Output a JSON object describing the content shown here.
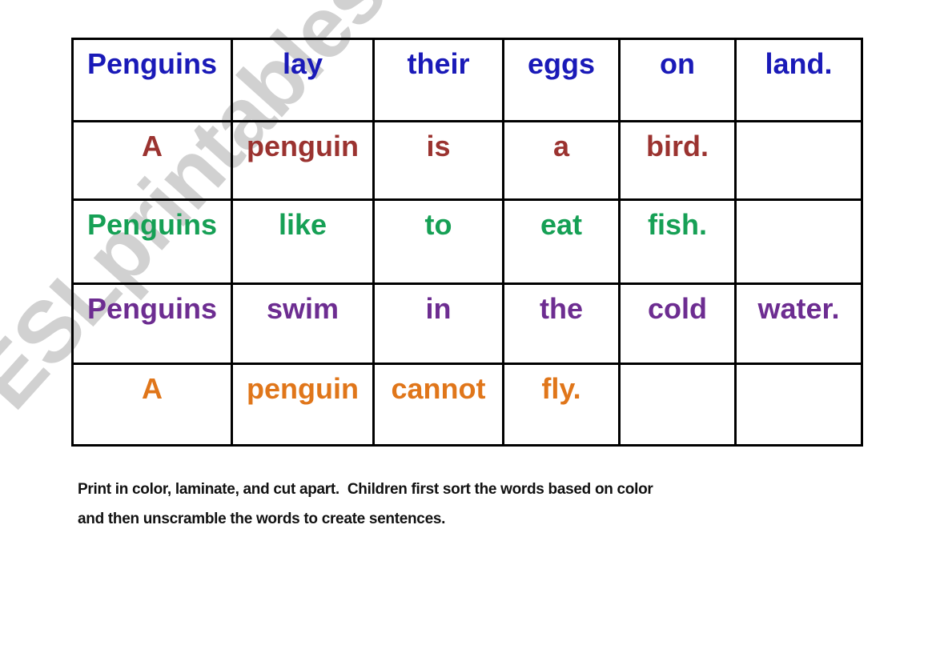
{
  "document": {
    "type": "printable-worksheet",
    "background_color": "#ffffff"
  },
  "watermark": {
    "text": "ESLprintables.com",
    "color": "#cfcfcf",
    "rotation_degrees": -48
  },
  "table": {
    "border_color": "#000000",
    "rows": [
      {
        "id": "sentence-blue",
        "color": "#1a1ab8",
        "color_name": "blue",
        "cells": [
          "Penguins",
          "lay",
          "their",
          "eggs",
          "on",
          "land."
        ]
      },
      {
        "id": "sentence-maroon",
        "color": "#9b3330",
        "color_name": "maroon",
        "cells": [
          "A",
          "penguin",
          "is",
          "a",
          "bird.",
          ""
        ]
      },
      {
        "id": "sentence-green",
        "color": "#16a055",
        "color_name": "green",
        "cells": [
          "Penguins",
          "like",
          "to",
          "eat",
          "fish.",
          ""
        ]
      },
      {
        "id": "sentence-purple",
        "color": "#6d2d91",
        "color_name": "purple",
        "cells": [
          "Penguins",
          "swim",
          "in",
          "the",
          "cold",
          "water."
        ]
      },
      {
        "id": "sentence-orange",
        "color": "#e0761a",
        "color_name": "orange",
        "cells": [
          "A",
          "penguin",
          "cannot",
          "fly.",
          "",
          ""
        ]
      }
    ]
  },
  "instructions": {
    "line1": "Print in color, laminate, and cut apart.  Children first sort the words based on color",
    "line2": "and then unscramble the words to create sentences."
  }
}
